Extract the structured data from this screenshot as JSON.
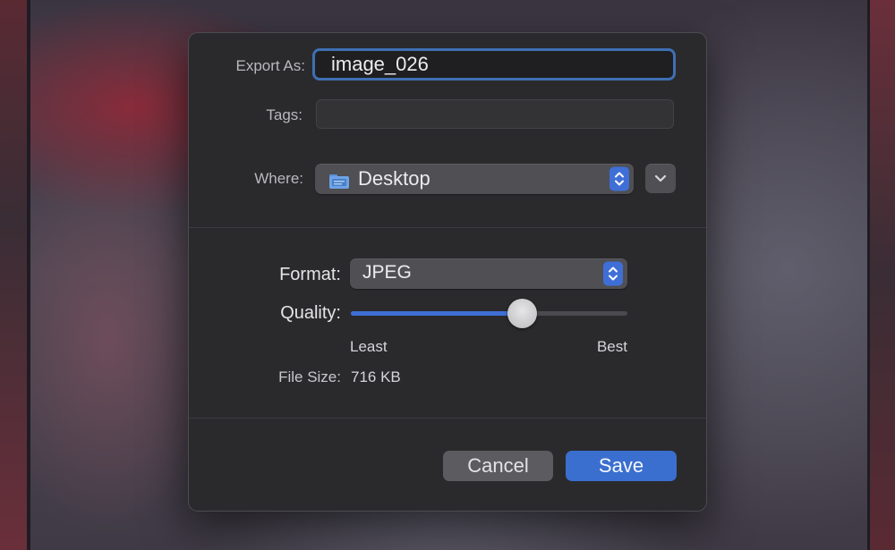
{
  "dialog": {
    "export_as_label": "Export As:",
    "filename": "image_026",
    "tags_label": "Tags:",
    "tags_value": "",
    "where_label": "Where:",
    "where_value": "Desktop",
    "format_label": "Format:",
    "format_value": "JPEG",
    "quality_label": "Quality:",
    "quality_level": 0.62,
    "quality_min_label": "Least",
    "quality_max_label": "Best",
    "file_size_label": "File Size:",
    "file_size_value": "716 KB",
    "cancel_label": "Cancel",
    "save_label": "Save"
  },
  "icons": {
    "where": "folder-icon",
    "stepper": "up-down-chevron-icon",
    "expand": "chevron-down-icon"
  },
  "colors": {
    "accent": "#3f6fd6",
    "focus_ring": "#3f6fb3",
    "dialog_bg": "#2a2a2d"
  }
}
